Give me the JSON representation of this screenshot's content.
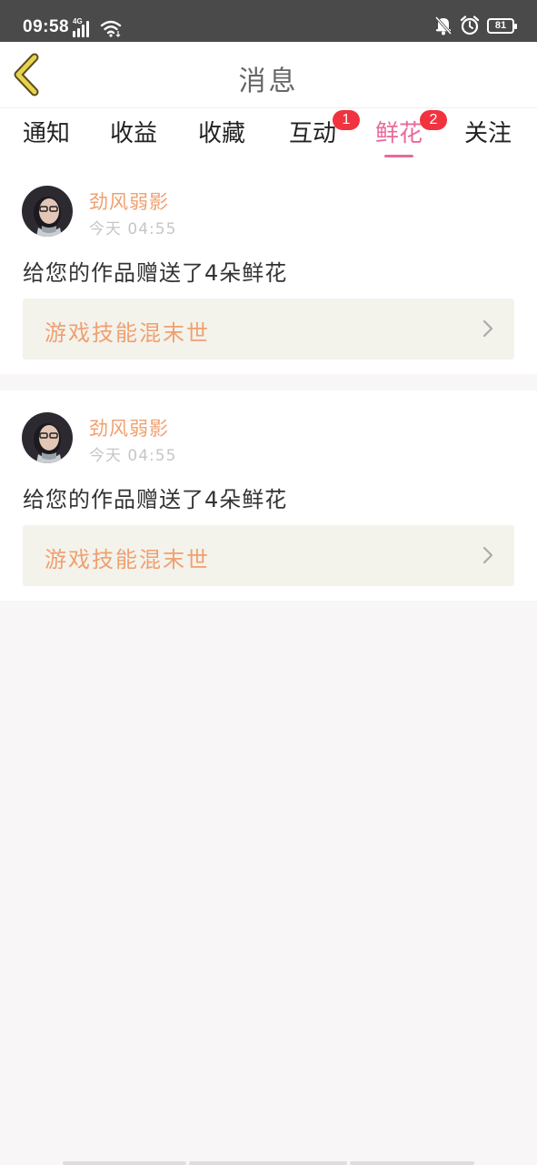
{
  "status_bar": {
    "time": "09:58",
    "network": "4G",
    "battery": "81",
    "icons": [
      "signal-icon",
      "wifi-icon",
      "notification-off-icon",
      "alarm-icon",
      "battery-icon"
    ]
  },
  "header": {
    "title": "消息",
    "back_icon": "chevron-left-icon"
  },
  "tabs": [
    {
      "label": "通知",
      "badge": null,
      "active": false
    },
    {
      "label": "收益",
      "badge": null,
      "active": false
    },
    {
      "label": "收藏",
      "badge": null,
      "active": false
    },
    {
      "label": "互动",
      "badge": "1",
      "active": false
    },
    {
      "label": "鲜花",
      "badge": "2",
      "active": true
    },
    {
      "label": "关注",
      "badge": null,
      "active": false
    }
  ],
  "messages": [
    {
      "sender": "劲风弱影",
      "time": "今天 04:55",
      "text": "给您的作品赠送了4朵鲜花",
      "work_title": "游戏技能混末世"
    },
    {
      "sender": "劲风弱影",
      "time": "今天 04:55",
      "text": "给您的作品赠送了4朵鲜花",
      "work_title": "游戏技能混末世"
    }
  ],
  "colors": {
    "accent": "#e86a9a",
    "name": "#f0a070",
    "badge": "#f0333f",
    "status_bar": "#4a4a4a"
  }
}
